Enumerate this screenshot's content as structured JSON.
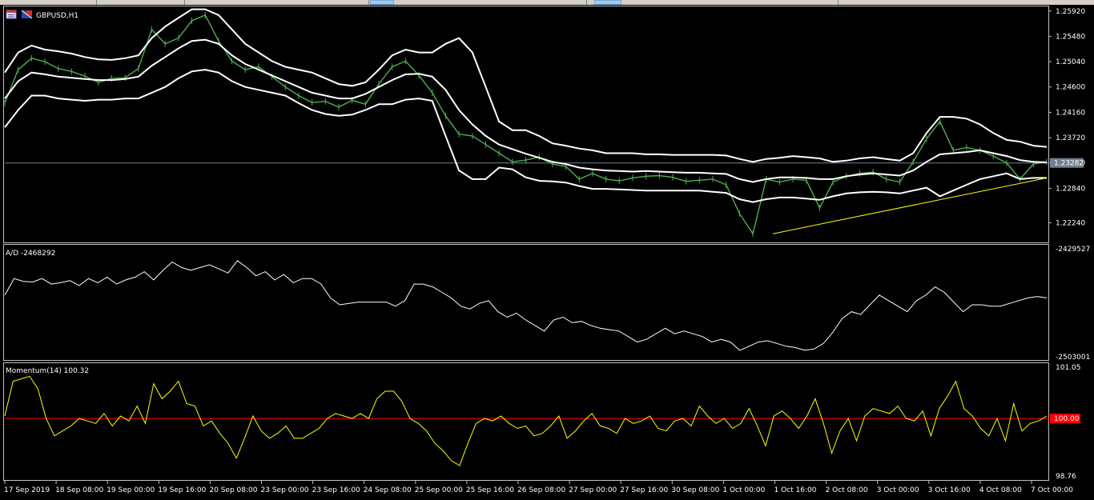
{
  "window": {
    "symbol_label": "GBPUSD,H1"
  },
  "chart_data": [
    {
      "type": "line",
      "title": "GBPUSD,H1",
      "ylim": [
        1.219,
        1.26
      ],
      "y_ticks": [
        "1.25920",
        "1.25480",
        "1.25040",
        "1.24600",
        "1.24160",
        "1.23720",
        "1.23280",
        "1.22840",
        "1.22240"
      ],
      "current_price_label": "1.23282",
      "current_price": 1.2328,
      "series": [
        {
          "name": "",
          "color": "#4caf50",
          "values": [
            1.2432,
            1.249,
            1.251,
            1.2504,
            1.2492,
            1.2487,
            1.2479,
            1.2468,
            1.2475,
            1.2476,
            1.2492,
            1.256,
            1.2535,
            1.2545,
            1.2575,
            1.2585,
            1.254,
            1.2505,
            1.249,
            1.2495,
            1.2478,
            1.246,
            1.2445,
            1.2433,
            1.2435,
            1.2425,
            1.2437,
            1.243,
            1.2465,
            1.2495,
            1.2505,
            1.248,
            1.245,
            1.241,
            1.2378,
            1.2375,
            1.236,
            1.2345,
            1.233,
            1.2333,
            1.2338,
            1.2326,
            1.2322,
            1.23,
            1.231,
            1.23,
            1.2297,
            1.2302,
            1.2305,
            1.2306,
            1.2303,
            1.2296,
            1.2298,
            1.23,
            1.229,
            1.224,
            1.2205,
            1.23,
            1.2295,
            1.23,
            1.2298,
            1.225,
            1.2295,
            1.2305,
            1.231,
            1.2312,
            1.23,
            1.2295,
            1.233,
            1.237,
            1.24,
            1.235,
            1.2355,
            1.235,
            1.234,
            1.2328,
            1.23,
            1.2326,
            1.233
          ]
        },
        {
          "name": "",
          "color": "#ffffff",
          "values": [
            1.2485,
            1.252,
            1.2532,
            1.2525,
            1.2522,
            1.2518,
            1.2512,
            1.2508,
            1.2507,
            1.251,
            1.2515,
            1.2545,
            1.2565,
            1.258,
            1.2595,
            1.2595,
            1.2585,
            1.256,
            1.2535,
            1.252,
            1.2505,
            1.2495,
            1.249,
            1.2485,
            1.2475,
            1.2465,
            1.2462,
            1.2468,
            1.249,
            1.2515,
            1.2525,
            1.252,
            1.252,
            1.2535,
            1.2545,
            1.252,
            1.246,
            1.24,
            1.2385,
            1.2385,
            1.2375,
            1.2362,
            1.2358,
            1.2353,
            1.235,
            1.2345,
            1.2345,
            1.2345,
            1.2343,
            1.2343,
            1.2342,
            1.2342,
            1.2342,
            1.2342,
            1.2341,
            1.2335,
            1.233,
            1.2335,
            1.2337,
            1.234,
            1.2338,
            1.2336,
            1.233,
            1.2332,
            1.2336,
            1.2338,
            1.2335,
            1.2332,
            1.2345,
            1.238,
            1.2408,
            1.2408,
            1.2405,
            1.2395,
            1.238,
            1.2368,
            1.2365,
            1.2358,
            1.2356
          ]
        },
        {
          "name": "",
          "color": "#ffffff",
          "values": [
            1.244,
            1.247,
            1.2485,
            1.2482,
            1.2478,
            1.2476,
            1.2474,
            1.2472,
            1.2472,
            1.2474,
            1.2478,
            1.2497,
            1.2512,
            1.2527,
            1.254,
            1.2542,
            1.2535,
            1.2515,
            1.25,
            1.249,
            1.248,
            1.247,
            1.246,
            1.245,
            1.2445,
            1.244,
            1.244,
            1.2448,
            1.246,
            1.2472,
            1.2482,
            1.2483,
            1.2478,
            1.2455,
            1.242,
            1.2395,
            1.2375,
            1.236,
            1.2352,
            1.2344,
            1.2337,
            1.233,
            1.2326,
            1.232,
            1.2317,
            1.2315,
            1.2314,
            1.2313,
            1.2314,
            1.2313,
            1.2312,
            1.2311,
            1.2311,
            1.231,
            1.2309,
            1.23,
            1.2295,
            1.23,
            1.2303,
            1.2303,
            1.2302,
            1.23,
            1.23,
            1.2305,
            1.2308,
            1.231,
            1.2308,
            1.2306,
            1.2315,
            1.233,
            1.2343,
            1.2345,
            1.2347,
            1.235,
            1.2345,
            1.234,
            1.2333,
            1.233,
            1.2329
          ]
        },
        {
          "name": "",
          "color": "#ffffff",
          "values": [
            1.239,
            1.242,
            1.2445,
            1.2445,
            1.244,
            1.2438,
            1.2436,
            1.2438,
            1.2438,
            1.244,
            1.244,
            1.245,
            1.246,
            1.2475,
            1.2487,
            1.249,
            1.2485,
            1.247,
            1.246,
            1.2455,
            1.245,
            1.2445,
            1.2432,
            1.242,
            1.2413,
            1.241,
            1.2412,
            1.242,
            1.243,
            1.243,
            1.2438,
            1.244,
            1.2436,
            1.2375,
            1.2315,
            1.23,
            1.23,
            1.232,
            1.2317,
            1.2303,
            1.2297,
            1.2296,
            1.2294,
            1.2288,
            1.2283,
            1.2283,
            1.2282,
            1.2281,
            1.228,
            1.228,
            1.228,
            1.228,
            1.228,
            1.2278,
            1.2276,
            1.2265,
            1.226,
            1.2265,
            1.2268,
            1.2268,
            1.2266,
            1.2264,
            1.227,
            1.2275,
            1.2277,
            1.2278,
            1.2277,
            1.2275,
            1.228,
            1.2285,
            1.227,
            1.228,
            1.229,
            1.23,
            1.2305,
            1.231,
            1.23,
            1.2302,
            1.2302
          ]
        }
      ],
      "trendline": {
        "color": "#ffff00",
        "from": 1.2205,
        "to": 1.2302
      }
    },
    {
      "type": "line",
      "title": "A/D -2468292",
      "y_ticks": [
        "-2429527",
        "-2503001"
      ],
      "ylim": [
        -2505000,
        -2425000
      ],
      "series": [
        {
          "name": "",
          "color": "#ffffff",
          "values": [
            -2458000,
            -2446000,
            -2448000,
            -2448500,
            -2446000,
            -2450000,
            -2449000,
            -2447500,
            -2451000,
            -2446000,
            -2449000,
            -2445000,
            -2450000,
            -2447000,
            -2445000,
            -2441000,
            -2447000,
            -2440000,
            -2434000,
            -2438000,
            -2440000,
            -2438000,
            -2436000,
            -2439000,
            -2442000,
            -2433000,
            -2438000,
            -2444000,
            -2441000,
            -2447000,
            -2443000,
            -2449000,
            -2446000,
            -2446000,
            -2450000,
            -2460000,
            -2465000,
            -2464000,
            -2463000,
            -2463000,
            -2463000,
            -2463000,
            -2466000,
            -2462000,
            -2450000,
            -2450000,
            -2452000,
            -2456000,
            -2460000,
            -2466000,
            -2468000,
            -2464000,
            -2462000,
            -2470000,
            -2474000,
            -2471000,
            -2476000,
            -2480000,
            -2484000,
            -2476000,
            -2474000,
            -2478000,
            -2477000,
            -2480000,
            -2482000,
            -2483000,
            -2484000,
            -2488000,
            -2492000,
            -2490000,
            -2486000,
            -2482000,
            -2486000,
            -2484000,
            -2486000,
            -2488000,
            -2492000,
            -2490000,
            -2492000,
            -2498000,
            -2495000,
            -2492000,
            -2491000,
            -2493000,
            -2495000,
            -2496000,
            -2498000,
            -2497000,
            -2493000,
            -2485000,
            -2475000,
            -2470000,
            -2472000,
            -2465000,
            -2458000,
            -2462000,
            -2466000,
            -2470000,
            -2462000,
            -2458000,
            -2452000,
            -2456000,
            -2463000,
            -2470000,
            -2465000,
            -2465000,
            -2466000,
            -2466000,
            -2464000,
            -2462000,
            -2460000,
            -2459000,
            -2460000
          ]
        }
      ]
    },
    {
      "type": "line",
      "title": "Momentum(14) 100.32",
      "y_ticks": [
        "101.05",
        "100.00",
        "98.76"
      ],
      "ylim": [
        98.76,
        101.05
      ],
      "reference_line": {
        "value": 100.0,
        "label": "100.00",
        "color": "#ff0000"
      },
      "series": [
        {
          "name": "",
          "color": "#ffff00",
          "values": [
            100.05,
            100.75,
            100.8,
            100.85,
            100.6,
            100.0,
            99.65,
            99.75,
            99.85,
            100.0,
            99.95,
            99.9,
            100.1,
            99.85,
            100.05,
            99.95,
            100.25,
            99.9,
            100.7,
            100.4,
            100.55,
            100.75,
            100.3,
            100.25,
            99.85,
            99.95,
            99.7,
            99.5,
            99.2,
            99.6,
            100.05,
            99.75,
            99.6,
            99.7,
            99.85,
            99.6,
            99.6,
            99.7,
            99.8,
            100.0,
            100.1,
            100.05,
            100.0,
            100.1,
            100.0,
            100.4,
            100.55,
            100.55,
            100.35,
            100.0,
            99.9,
            99.75,
            99.5,
            99.35,
            99.15,
            99.05,
            99.5,
            99.9,
            100.0,
            99.95,
            100.05,
            99.9,
            99.8,
            99.85,
            99.65,
            99.7,
            99.85,
            100.05,
            99.6,
            99.75,
            99.95,
            100.1,
            99.85,
            99.8,
            99.7,
            100.0,
            99.9,
            99.95,
            100.05,
            99.8,
            99.75,
            99.95,
            100.0,
            99.85,
            100.25,
            100.05,
            99.9,
            100.0,
            99.8,
            99.9,
            100.2,
            99.85,
            99.45,
            100.05,
            100.15,
            100.0,
            99.8,
            100.05,
            100.4,
            99.9,
            99.3,
            99.75,
            100.0,
            99.55,
            100.05,
            100.2,
            100.15,
            100.1,
            100.25,
            100.0,
            99.95,
            100.15,
            99.65,
            100.2,
            100.45,
            100.75,
            100.2,
            100.05,
            99.8,
            99.65,
            100.0,
            99.55,
            100.3,
            99.75,
            99.9,
            99.95,
            100.05
          ]
        }
      ]
    }
  ],
  "x_axis_labels": [
    "17 Sep 2019",
    "18 Sep 08:00",
    "19 Sep 00:00",
    "19 Sep 16:00",
    "20 Sep 08:00",
    "23 Sep 00:00",
    "23 Sep 16:00",
    "24 Sep 08:00",
    "25 Sep 00:00",
    "25 Sep 16:00",
    "26 Sep 08:00",
    "27 Sep 00:00",
    "27 Sep 16:00",
    "30 Sep 08:00",
    "1 Oct 00:00",
    "1 Oct 16:00",
    "2 Oct 08:00",
    "3 Oct 00:00",
    "3 Oct 16:00",
    "4 Oct 08:00",
    "7 Oct 00:00"
  ]
}
